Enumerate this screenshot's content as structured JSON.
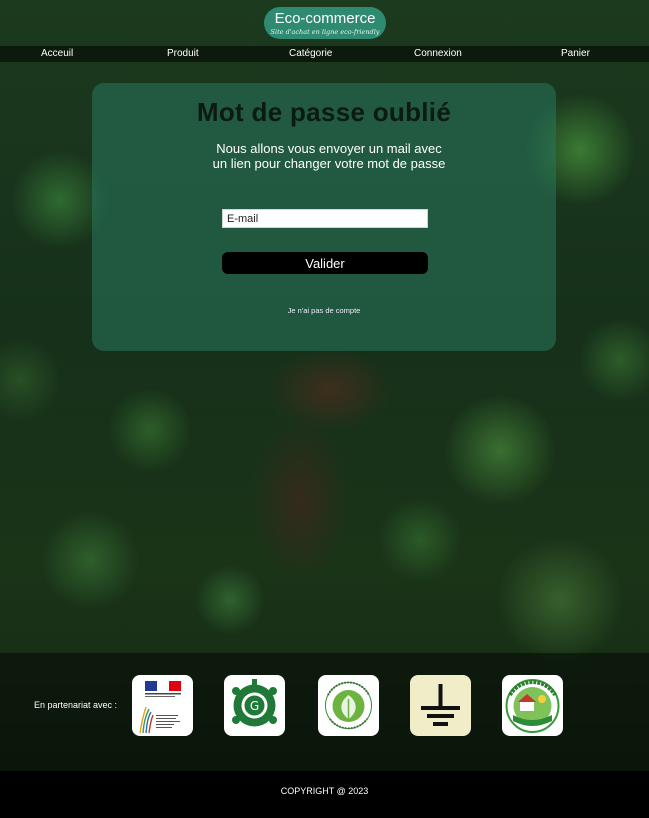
{
  "header": {
    "logo_title": "Eco-commerce",
    "logo_tagline": "Site d'achat en ligne eco-friendly"
  },
  "nav": {
    "items": [
      "Acceuil",
      "Produit",
      "Catégorie",
      "Connexion",
      "Panier"
    ]
  },
  "form": {
    "title": "Mot de passe oublié",
    "description": "Nous allons vous envoyer un mail avec un lien pour changer votre mot de passe",
    "email_placeholder": "E-mail",
    "submit_label": "Valider",
    "no_account_link": "Je n'ai pas de compte"
  },
  "partners": {
    "label": "En partenariat avec :",
    "logos": [
      {
        "name": "ministere-transition-ecologique",
        "icon": "french-ministry-logo",
        "text": "Ministère de la Transition Écologique et Solidaire"
      },
      {
        "name": "green-earth",
        "icon": "green-earth-logo"
      },
      {
        "name": "ecologie-universelle",
        "icon": "ecologie-universelle-logo",
        "text": "ECOLOGIE UNIVERSELLE"
      },
      {
        "name": "ground-symbol",
        "icon": "ground-symbol-logo"
      },
      {
        "name": "accueil-paysan",
        "icon": "accueil-paysan-logo",
        "text": "ACCUEIL PAYSAN Occitanie"
      }
    ]
  },
  "footer": {
    "copyright": "COPYRIGHT @ 2023"
  },
  "colors": {
    "logo_bg": "#2f8a72",
    "card_bg": "#28785f",
    "button_bg": "#000000",
    "footer_bg": "#000000"
  }
}
